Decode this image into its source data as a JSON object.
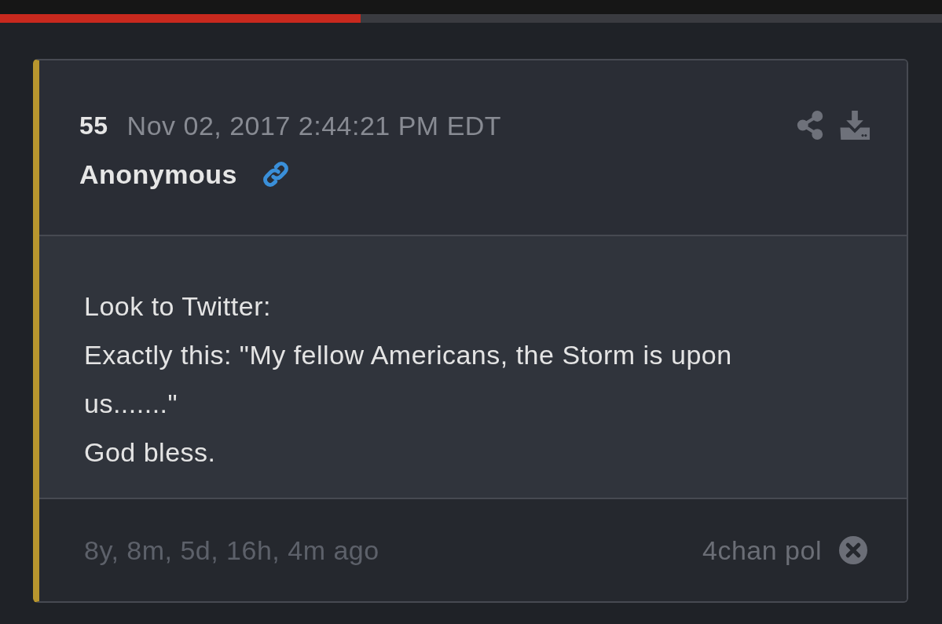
{
  "progress": {
    "level": 0.383
  },
  "post": {
    "number": "55",
    "timestamp": "Nov 02, 2017 2:44:21 PM EDT",
    "author": "Anonymous",
    "body": [
      "Look to Twitter:",
      "Exactly this: \"My fellow Americans, the Storm is upon us.......\"",
      "God bless."
    ],
    "age": "8y, 8m, 5d, 16h, 4m ago",
    "source": "4chan pol"
  }
}
